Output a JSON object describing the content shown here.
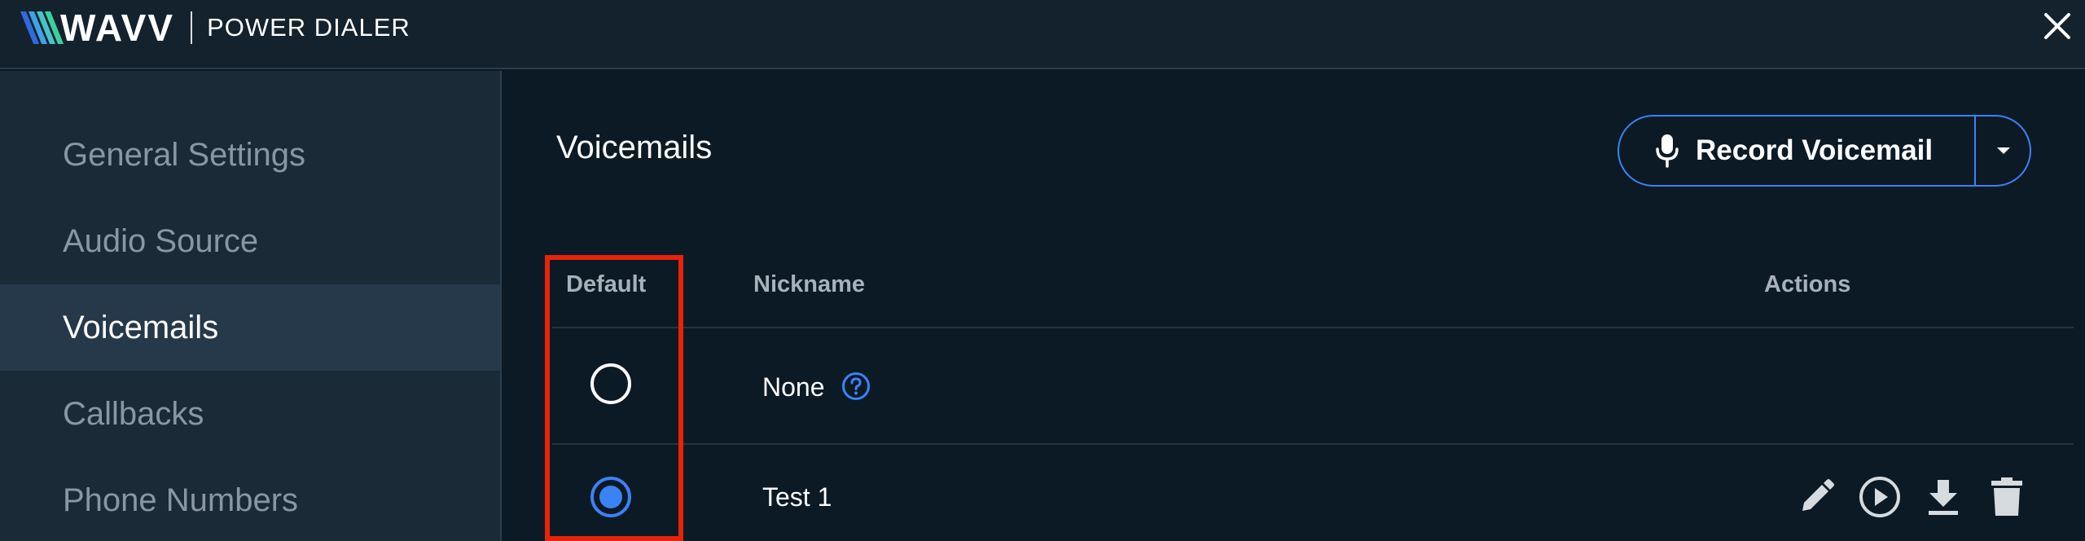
{
  "header": {
    "brand": "WAVV",
    "product": "POWER DIALER",
    "stripe_colors": [
      "#2f6bdc",
      "#3ea3e6",
      "#46c3c8",
      "#3ad0a0"
    ]
  },
  "close_icon": "close-icon",
  "sidebar": {
    "items": [
      {
        "label": "General Settings",
        "active": false
      },
      {
        "label": "Audio Source",
        "active": false
      },
      {
        "label": "Voicemails",
        "active": true
      },
      {
        "label": "Callbacks",
        "active": false
      },
      {
        "label": "Phone Numbers",
        "active": false
      }
    ]
  },
  "main": {
    "title": "Voicemails",
    "record_button": {
      "label": "Record Voicemail",
      "icon": "microphone-icon",
      "dropdown_icon": "caret-down-icon"
    },
    "table": {
      "headers": {
        "default": "Default",
        "nickname": "Nickname",
        "actions": "Actions"
      },
      "rows": [
        {
          "nickname": "None",
          "selected": false,
          "help_icon": "question-circle-icon",
          "actions": []
        },
        {
          "nickname": "Test 1",
          "selected": true,
          "actions": [
            "pencil-icon",
            "play-circle-icon",
            "download-icon",
            "trash-icon"
          ]
        }
      ]
    }
  },
  "colors": {
    "accent": "#3b82f6",
    "highlight": "#e8230a",
    "background": "#0c1a26",
    "sidebar": "#1a2a37"
  }
}
